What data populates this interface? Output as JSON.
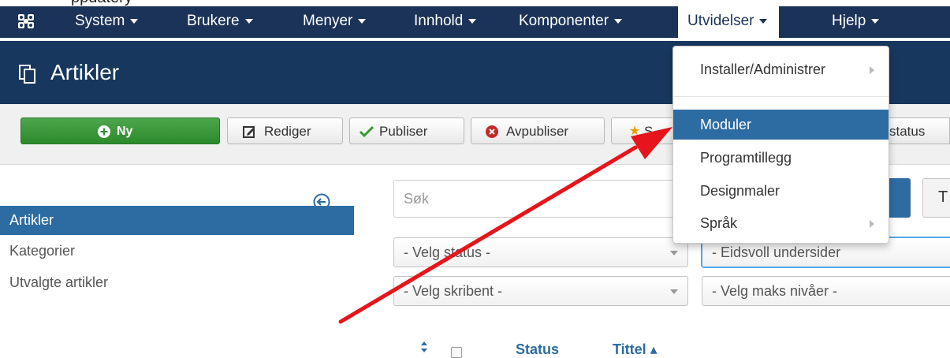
{
  "top_strip": {
    "text": "          ppdatery"
  },
  "navbar": {
    "items": [
      {
        "label": "System"
      },
      {
        "label": "Brukere"
      },
      {
        "label": "Menyer"
      },
      {
        "label": "Innhold"
      },
      {
        "label": "Komponenter"
      },
      {
        "label": "Utvidelser"
      },
      {
        "label": "Hjelp"
      }
    ]
  },
  "title_bar": {
    "title": "Artikler"
  },
  "toolbar": {
    "new_label": "Ny",
    "edit_label": "Rediger",
    "publish_label": "Publiser",
    "unpublish_label": "Avpubliser",
    "featured_label_partial": "S",
    "status_label_partial": "status"
  },
  "sidebar": {
    "items": [
      {
        "label": "Artikler"
      },
      {
        "label": "Kategorier"
      },
      {
        "label": "Utvalgte artikler"
      }
    ]
  },
  "filters": {
    "search_placeholder": "Søk",
    "tools_partial": "T",
    "status_select": "- Velg status -",
    "category_select": "- Eidsvoll undersider",
    "author_select": "- Velg skribent -",
    "level_select": "- Velg maks nivåer -"
  },
  "table": {
    "col_status": "Status",
    "col_title": "Tittel ▴"
  },
  "dropdown": {
    "items": [
      {
        "label": "Installer/Administrer"
      },
      {
        "label": "Moduler"
      },
      {
        "label": "Programtillegg"
      },
      {
        "label": "Designmaler"
      },
      {
        "label": "Språk"
      }
    ]
  },
  "colors": {
    "navbar": "#1b3358",
    "title_bar": "#17375e",
    "accent": "#2d6ca2",
    "new_button": "#2f8f2f",
    "annotation_arrow": "#e8141b"
  }
}
